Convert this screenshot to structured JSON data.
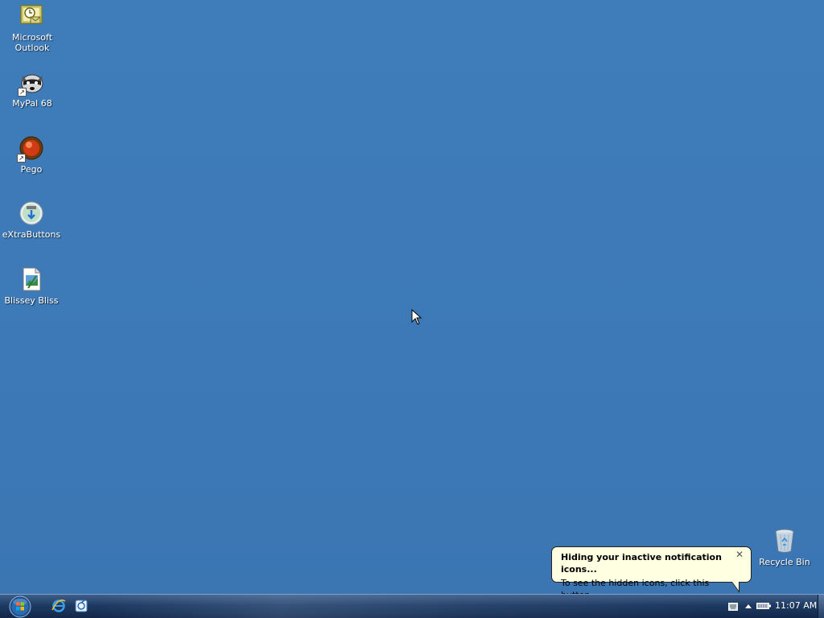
{
  "desktop": {
    "icons": [
      {
        "label": "Microsoft\nOutlook",
        "icon": "outlook-icon",
        "shortcut": false
      },
      {
        "label": "MyPal 68",
        "icon": "mypal-raccoon-icon",
        "shortcut": true
      },
      {
        "label": "Pego",
        "icon": "pego-icon",
        "shortcut": true
      },
      {
        "label": "eXtraButtons",
        "icon": "extrabuttons-icon",
        "shortcut": false
      },
      {
        "label": "Blissey Bliss",
        "icon": "blissey-bliss-icon",
        "shortcut": false
      }
    ],
    "recycle_bin": {
      "label": "Recycle Bin",
      "icon": "recycle-bin-icon"
    }
  },
  "balloon": {
    "title": "Hiding your inactive notification icons...",
    "text": "To see the hidden icons, click this button.",
    "close": "✕"
  },
  "taskbar": {
    "start": "start-orb-icon",
    "quick_launch": [
      "internet-explorer-icon",
      "email-client-icon"
    ],
    "tray_icons": [
      "keyboard-icon",
      "show-hidden-icons-chevron-icon",
      "battery-icon"
    ],
    "clock": "11:07 AM"
  },
  "colors": {
    "desktop_background": "#3e7ab8",
    "balloon_background": "#ffffe1",
    "taskbar": "#1e3a62"
  }
}
